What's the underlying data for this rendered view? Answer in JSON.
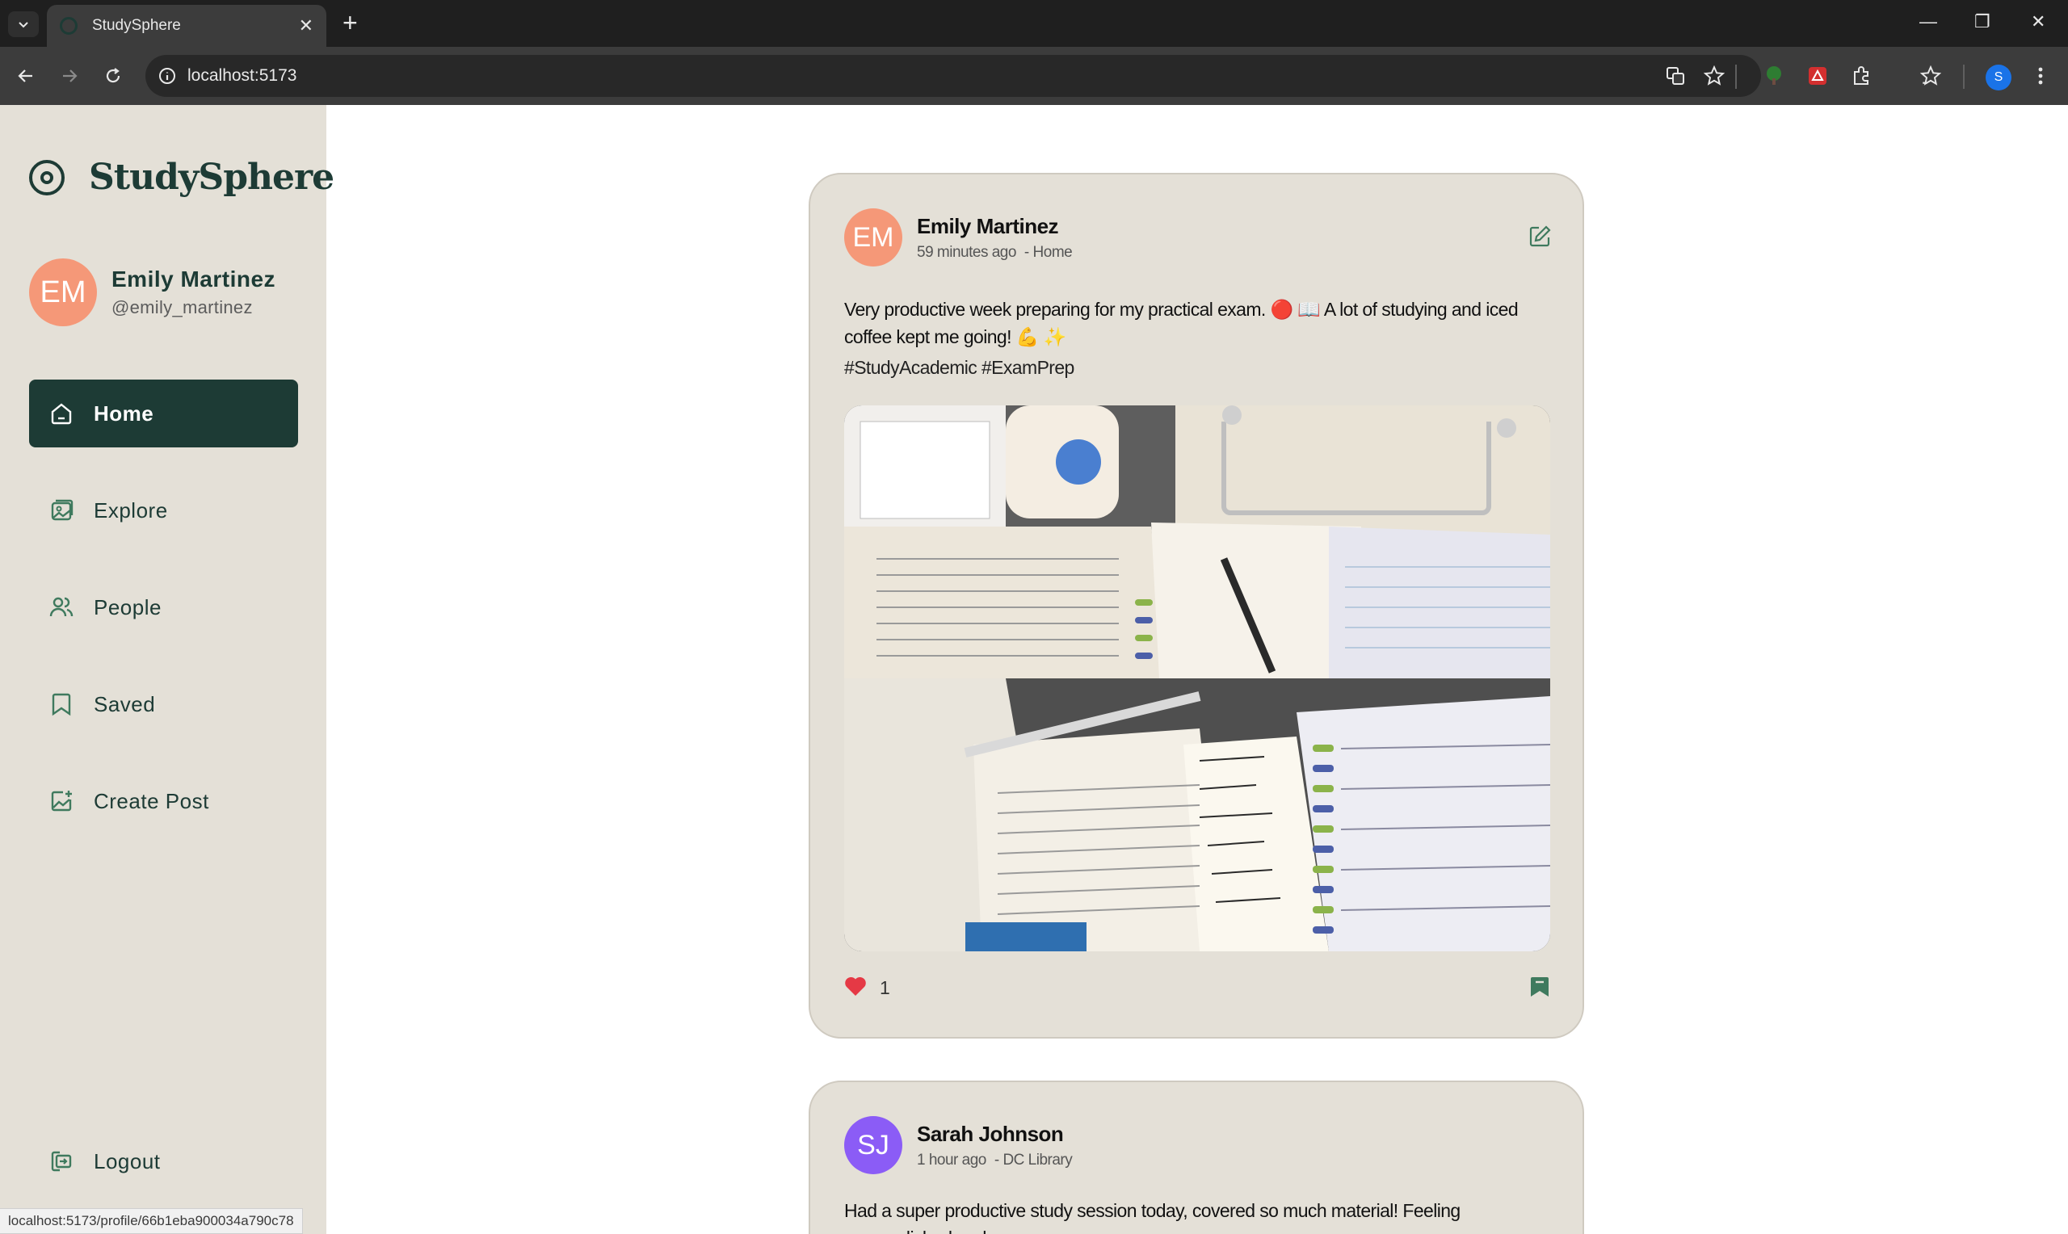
{
  "browser": {
    "tab_title": "StudySphere",
    "url": "localhost:5173",
    "status_url": "localhost:5173/profile/66b1eba900034a790c78",
    "profile_initial": "S"
  },
  "app": {
    "name": "StudySphere",
    "accent_color": "#1d3b35",
    "sidebar_bg": "#e4e0d7"
  },
  "user": {
    "initials": "EM",
    "name": "Emily Martinez",
    "handle": "@emily_martinez",
    "avatar_color": "#f59878"
  },
  "nav": {
    "home": "Home",
    "explore": "Explore",
    "people": "People",
    "saved": "Saved",
    "create_post": "Create Post",
    "logout": "Logout",
    "active": "Home"
  },
  "posts": [
    {
      "initials": "EM",
      "author": "Emily Martinez",
      "avatar_color": "#f59878",
      "time": "59 minutes ago",
      "location": "- Home",
      "body": "Very productive week preparing for my practical exam. 🔴 📖 A lot of studying and iced coffee kept me going! 💪 ✨",
      "tags": "#StudyAcademic #ExamPrep",
      "likes": "1",
      "liked": true,
      "saved": true
    },
    {
      "initials": "SJ",
      "author": "Sarah Johnson",
      "avatar_color": "#8b5cf6",
      "time": "1 hour ago",
      "location": "- DC Library",
      "body": "Had a super productive study session today, covered so much material! Feeling accomplished and"
    }
  ]
}
